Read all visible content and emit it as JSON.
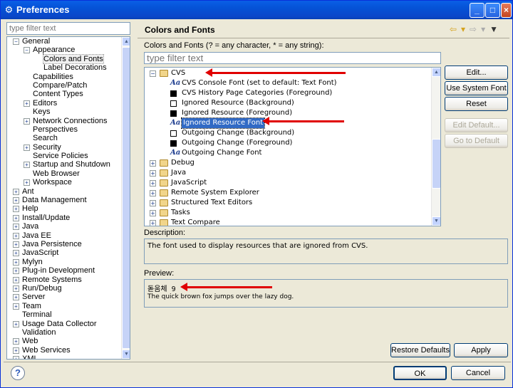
{
  "window": {
    "title": "Preferences",
    "buttons": [
      "_",
      "□",
      "×"
    ]
  },
  "left": {
    "filter_placeholder": "type filter text",
    "tree": [
      {
        "label": "General",
        "depth": 0,
        "exp": "-"
      },
      {
        "label": "Appearance",
        "depth": 1,
        "exp": "-"
      },
      {
        "label": "Colors and Fonts",
        "depth": 2,
        "exp": "",
        "selected": true
      },
      {
        "label": "Label Decorations",
        "depth": 2,
        "exp": ""
      },
      {
        "label": "Capabilities",
        "depth": 1,
        "exp": ""
      },
      {
        "label": "Compare/Patch",
        "depth": 1,
        "exp": ""
      },
      {
        "label": "Content Types",
        "depth": 1,
        "exp": ""
      },
      {
        "label": "Editors",
        "depth": 1,
        "exp": "+"
      },
      {
        "label": "Keys",
        "depth": 1,
        "exp": ""
      },
      {
        "label": "Network Connections",
        "depth": 1,
        "exp": "+"
      },
      {
        "label": "Perspectives",
        "depth": 1,
        "exp": ""
      },
      {
        "label": "Search",
        "depth": 1,
        "exp": ""
      },
      {
        "label": "Security",
        "depth": 1,
        "exp": "+"
      },
      {
        "label": "Service Policies",
        "depth": 1,
        "exp": ""
      },
      {
        "label": "Startup and Shutdown",
        "depth": 1,
        "exp": "+"
      },
      {
        "label": "Web Browser",
        "depth": 1,
        "exp": ""
      },
      {
        "label": "Workspace",
        "depth": 1,
        "exp": "+"
      },
      {
        "label": "Ant",
        "depth": 0,
        "exp": "+"
      },
      {
        "label": "Data Management",
        "depth": 0,
        "exp": "+"
      },
      {
        "label": "Help",
        "depth": 0,
        "exp": "+"
      },
      {
        "label": "Install/Update",
        "depth": 0,
        "exp": "+"
      },
      {
        "label": "Java",
        "depth": 0,
        "exp": "+"
      },
      {
        "label": "Java EE",
        "depth": 0,
        "exp": "+"
      },
      {
        "label": "Java Persistence",
        "depth": 0,
        "exp": "+"
      },
      {
        "label": "JavaScript",
        "depth": 0,
        "exp": "+"
      },
      {
        "label": "Mylyn",
        "depth": 0,
        "exp": "+"
      },
      {
        "label": "Plug-in Development",
        "depth": 0,
        "exp": "+"
      },
      {
        "label": "Remote Systems",
        "depth": 0,
        "exp": "+"
      },
      {
        "label": "Run/Debug",
        "depth": 0,
        "exp": "+"
      },
      {
        "label": "Server",
        "depth": 0,
        "exp": "+"
      },
      {
        "label": "Team",
        "depth": 0,
        "exp": "+"
      },
      {
        "label": "Terminal",
        "depth": 0,
        "exp": ""
      },
      {
        "label": "Usage Data Collector",
        "depth": 0,
        "exp": "+"
      },
      {
        "label": "Validation",
        "depth": 0,
        "exp": ""
      },
      {
        "label": "Web",
        "depth": 0,
        "exp": "+"
      },
      {
        "label": "Web Services",
        "depth": 0,
        "exp": "+"
      },
      {
        "label": "XML",
        "depth": 0,
        "exp": "+"
      }
    ]
  },
  "right": {
    "title": "Colors and Fonts",
    "nav_icons": [
      "back-arrow-icon",
      "forward-arrow-icon",
      "view-menu-icon"
    ],
    "filter_label": "Colors and Fonts (? = any character, * = any string):",
    "filter_placeholder": "type filter text",
    "tree": [
      {
        "label": "CVS",
        "kind": "folder",
        "exp": "-",
        "depth": 0
      },
      {
        "label": "CVS Console Font (set to default: Text Font)",
        "kind": "font",
        "depth": 1
      },
      {
        "label": "CVS History Page Categories (Foreground)",
        "kind": "black",
        "depth": 1
      },
      {
        "label": "Ignored Resource (Background)",
        "kind": "white",
        "depth": 1
      },
      {
        "label": "Ignored Resource (Foreground)",
        "kind": "black",
        "depth": 1
      },
      {
        "label": "Ignored Resource Font",
        "kind": "font",
        "depth": 1,
        "selected": true
      },
      {
        "label": "Outgoing Change (Background)",
        "kind": "white",
        "depth": 1
      },
      {
        "label": "Outgoing Change (Foreground)",
        "kind": "black",
        "depth": 1
      },
      {
        "label": "Outgoing Change Font",
        "kind": "font",
        "depth": 1
      },
      {
        "label": "Debug",
        "kind": "folder",
        "exp": "+",
        "depth": 0
      },
      {
        "label": "Java",
        "kind": "folder",
        "exp": "+",
        "depth": 0
      },
      {
        "label": "JavaScript",
        "kind": "folder",
        "exp": "+",
        "depth": 0
      },
      {
        "label": "Remote System Explorer",
        "kind": "folder",
        "exp": "+",
        "depth": 0
      },
      {
        "label": "Structured Text Editors",
        "kind": "folder",
        "exp": "+",
        "depth": 0
      },
      {
        "label": "Tasks",
        "kind": "folder",
        "exp": "+",
        "depth": 0
      },
      {
        "label": "Text Compare",
        "kind": "folder",
        "exp": "+",
        "depth": 0
      }
    ],
    "buttons": {
      "edit": "Edit...",
      "use_system_font": "Use System Font",
      "reset": "Reset",
      "edit_default": "Edit Default...",
      "go_to_default": "Go to Default"
    },
    "description_label": "Description:",
    "description_text": "The font used to display resources that are ignored from CVS.",
    "preview_label": "Preview:",
    "preview_line1": "돋움체 9",
    "preview_line2": "The quick brown fox jumps over the lazy dog.",
    "restore_defaults": "Restore Defaults",
    "apply": "Apply"
  },
  "footer": {
    "help_icon": "help-icon",
    "ok": "OK",
    "cancel": "Cancel"
  },
  "colors": {
    "annotation_arrow": "#e00000",
    "selection": "#316ac5",
    "titlebar": "#0a47c9"
  }
}
